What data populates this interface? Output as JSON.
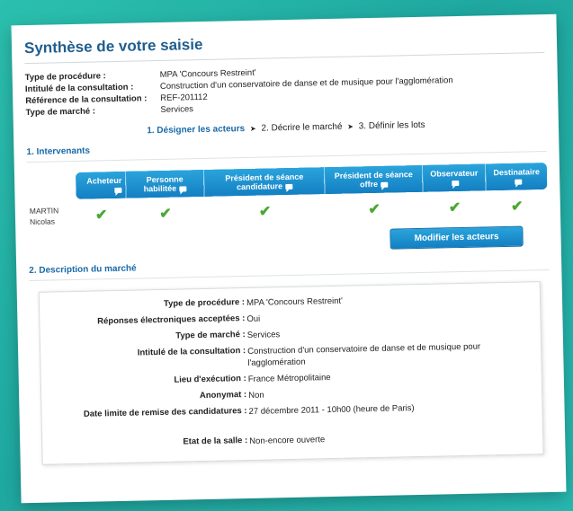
{
  "page": {
    "title": "Synthèse de votre saisie"
  },
  "summary": [
    {
      "label": "Type de procédure :",
      "value": "MPA 'Concours Restreint'"
    },
    {
      "label": "Intitulé de la consultation :",
      "value": "Construction d'un conservatoire de danse et de musique pour l'agglomération"
    },
    {
      "label": "Référence de la consultation :",
      "value": "REF-201112"
    },
    {
      "label": "Type de marché :",
      "value": "Services"
    }
  ],
  "steps": [
    {
      "label": "1. Désigner les acteurs",
      "active": true
    },
    {
      "label": "2. Décrire le marché",
      "active": false
    },
    {
      "label": "3. Définir les lots",
      "active": false
    }
  ],
  "section1": {
    "title": "1. Intervenants"
  },
  "actors_table": {
    "headers": [
      "Acheteur",
      "Personne habilitée",
      "Président de séance candidature",
      "Président de séance offre",
      "Observateur",
      "Destinataire"
    ],
    "rows": [
      {
        "name_line1": "MARTIN",
        "name_line2": "Nicolas",
        "checks": [
          true,
          true,
          true,
          true,
          true,
          true
        ]
      }
    ]
  },
  "modify_button": {
    "label": "Modifier les acteurs"
  },
  "section2": {
    "title": "2. Description du marché"
  },
  "description": [
    {
      "label": "Type de procédure",
      "value": "MPA 'Concours Restreint'"
    },
    {
      "label": "Réponses électroniques acceptées",
      "value": "Oui"
    },
    {
      "label": "Type de marché",
      "value": "Services"
    },
    {
      "label": "Intitulé de la consultation",
      "value": "Construction d'un conservatoire de danse et de musique pour l'agglomération"
    },
    {
      "label": "Lieu d'exécution",
      "value": "France Métropolitaine"
    },
    {
      "label": "Anonymat",
      "value": "Non"
    },
    {
      "label": "Date limite de remise des candidatures",
      "value": "27 décembre 2011 - 10h00 (heure de Paris)"
    },
    {
      "label": "Etat de la salle",
      "value": "Non-encore ouverte"
    }
  ],
  "colors": {
    "title": "#1f5e8e",
    "accent": "#1a6aa8",
    "header_blue": "#137fc2",
    "check_green": "#4aa832",
    "background": "#23b3a8"
  },
  "icons": {
    "header_icon": "chat-bubble-icon",
    "row_mark": "checkmark-icon",
    "step_separator": "arrow-right-icon"
  }
}
